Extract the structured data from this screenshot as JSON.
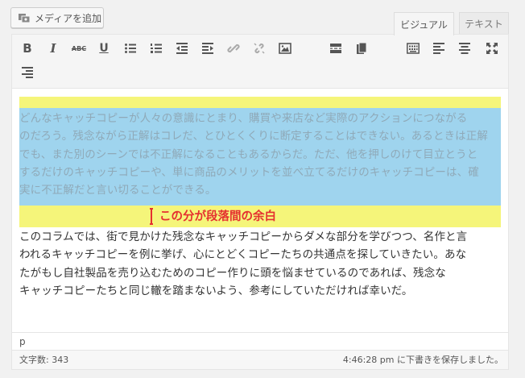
{
  "media_button": {
    "label": "メディアを追加",
    "icon": "media-icon"
  },
  "tabs": [
    {
      "label": "ビジュアル",
      "active": true
    },
    {
      "label": "テキスト",
      "active": false
    }
  ],
  "toolbar": {
    "row1": [
      "bold-icon",
      "italic-icon",
      "strikethrough-icon",
      "underline-icon",
      "bullet-list-icon",
      "numbered-list-icon",
      "outdent-icon",
      "indent-icon",
      "link-icon",
      "unlink-icon",
      "image-icon",
      "more-tag-icon",
      "paste-icon",
      "toolbar-toggle-icon",
      "align-left-icon",
      "align-center-icon",
      "fullscreen-icon"
    ],
    "row2": [
      "align-right-icon"
    ],
    "bold_label": "B",
    "italic_label": "I",
    "strike_label": "ABC",
    "underline_label": "U"
  },
  "content": {
    "paragraph1": [
      "どんなキャッチコピーが人々の意識にとまり、購買や来店など実際のアクションにつながる",
      "のだろう。残念ながら正解はコレだ、とひとくくりに断定することはできない。あるときは正解",
      "でも、また別のシーンでは不正解になることもあるからだ。ただ、他を押しのけて目立とうと",
      "するだけのキャッチコピーや、単に商品のメリットを並べ立てるだけのキャッチコピーは、確",
      "実に不正解だと言い切ることができる。"
    ],
    "annotation": "この分が段落間の余白",
    "paragraph2": [
      "このコラムでは、街で見かけた残念なキャッチコピーからダメな部分を学びつつ、名作と言",
      "われるキャッチコピーを例に挙げ、心にとどくコピーたちの共通点を探していきたい。あな",
      "たがもし自社製品を売り込むためのコピー作りに頭を悩ませているのであれば、残念な",
      "キャッチコピーたちと同じ轍を踏まないよう、参考にしていただければ幸いだ。"
    ]
  },
  "path": "p",
  "status": {
    "word_count": "文字数: 343",
    "saved": "4:46:28 pm に下書きを保存しました。"
  },
  "colors": {
    "highlight_yellow": "#f5f57a",
    "highlight_blue": "#9fd4ee",
    "annotation_red": "#e53030"
  }
}
